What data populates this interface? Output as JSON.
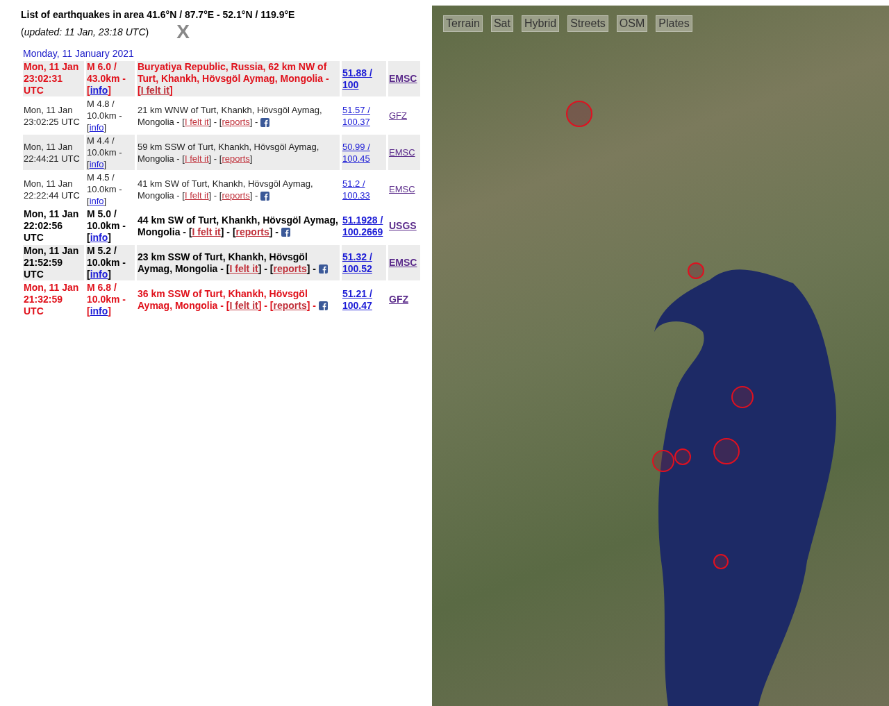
{
  "header": {
    "title": "List of earthquakes in area 41.6°N / 87.7°E - 52.1°N / 119.9°E",
    "updated_open": "(",
    "updated": "updated: 11 Jan, 23:18 UTC",
    "updated_close": ")",
    "close": "X"
  },
  "day": "Monday, 11 January 2021",
  "rows": [
    {
      "kind": "major",
      "shaded": true,
      "date": "Mon, 11 Jan 23:02:31 UTC",
      "magnitude": [
        {
          "kind": "text",
          "text": "M 6.0 / 43.0km - ["
        },
        {
          "kind": "info",
          "text": "info"
        },
        {
          "kind": "text",
          "text": "]"
        }
      ],
      "place": [
        {
          "kind": "text",
          "text": "Buryatiya Republic, Russia, 62 km NW of Turt, Khankh, Hövsgöl Aymag, Mongolia - ["
        },
        {
          "kind": "felt",
          "text": "I felt it"
        },
        {
          "kind": "text",
          "text": "]"
        }
      ],
      "coords": "51.88 / 100",
      "source": "EMSC"
    },
    {
      "kind": "minor",
      "shaded": false,
      "date": "Mon, 11 Jan 23:02:25 UTC",
      "magnitude": [
        {
          "kind": "text",
          "text": "M 4.8 / 10.0km - ["
        },
        {
          "kind": "info",
          "text": "info"
        },
        {
          "kind": "text",
          "text": "]"
        }
      ],
      "place": [
        {
          "kind": "text",
          "text": "21 km WNW of Turt, Khankh, Hövsgöl Aymag, Mongolia - ["
        },
        {
          "kind": "felt",
          "text": "I felt it"
        },
        {
          "kind": "text",
          "text": "] - ["
        },
        {
          "kind": "reports",
          "text": "reports"
        },
        {
          "kind": "text",
          "text": "] - "
        },
        {
          "kind": "share"
        }
      ],
      "coords": "51.57 / 100.37",
      "source": "GFZ"
    },
    {
      "kind": "minor",
      "shaded": true,
      "date": "Mon, 11 Jan 22:44:21 UTC",
      "magnitude": [
        {
          "kind": "text",
          "text": "M 4.4 / 10.0km - ["
        },
        {
          "kind": "info",
          "text": "info"
        },
        {
          "kind": "text",
          "text": "]"
        }
      ],
      "place": [
        {
          "kind": "text",
          "text": "59 km SSW of Turt, Khankh, Hövsgöl Aymag, Mongolia - ["
        },
        {
          "kind": "felt",
          "text": "I felt it"
        },
        {
          "kind": "text",
          "text": "] - ["
        },
        {
          "kind": "reports",
          "text": "reports"
        },
        {
          "kind": "text",
          "text": "]"
        }
      ],
      "coords": "50.99 / 100.45",
      "source": "EMSC"
    },
    {
      "kind": "minor",
      "shaded": false,
      "date": "Mon, 11 Jan 22:22:44 UTC",
      "magnitude": [
        {
          "kind": "text",
          "text": "M 4.5 / 10.0km - ["
        },
        {
          "kind": "info",
          "text": "info"
        },
        {
          "kind": "text",
          "text": "]"
        }
      ],
      "place": [
        {
          "kind": "text",
          "text": "41 km SW of Turt, Khankh, Hövsgöl Aymag, Mongolia - ["
        },
        {
          "kind": "felt",
          "text": "I felt it"
        },
        {
          "kind": "text",
          "text": "] - ["
        },
        {
          "kind": "reports",
          "text": "reports"
        },
        {
          "kind": "text",
          "text": "] - "
        },
        {
          "kind": "share"
        }
      ],
      "coords": "51.2 / 100.33",
      "source": "EMSC"
    },
    {
      "kind": "strong",
      "shaded": false,
      "date": "Mon, 11 Jan 22:02:56 UTC",
      "magnitude": [
        {
          "kind": "text",
          "text": "M 5.0 / 10.0km - ["
        },
        {
          "kind": "info",
          "text": "info"
        },
        {
          "kind": "text",
          "text": "]"
        }
      ],
      "place": [
        {
          "kind": "text",
          "text": "44 km SW of Turt, Khankh, Hövsgöl Aymag, Mongolia - ["
        },
        {
          "kind": "felt",
          "text": "I felt it"
        },
        {
          "kind": "text",
          "text": "] - ["
        },
        {
          "kind": "reports",
          "text": "reports"
        },
        {
          "kind": "text",
          "text": "] - "
        },
        {
          "kind": "share"
        }
      ],
      "coords": "51.1928 / 100.2669",
      "source": "USGS"
    },
    {
      "kind": "strong",
      "shaded": true,
      "date": "Mon, 11 Jan 21:52:59 UTC",
      "magnitude": [
        {
          "kind": "text",
          "text": "M 5.2 / 10.0km - ["
        },
        {
          "kind": "info",
          "text": "info"
        },
        {
          "kind": "text",
          "text": "]"
        }
      ],
      "place": [
        {
          "kind": "text",
          "text": "23 km SSW of Turt, Khankh, Hövsgöl Aymag, Mongolia - ["
        },
        {
          "kind": "felt",
          "text": "I felt it"
        },
        {
          "kind": "text",
          "text": "] - ["
        },
        {
          "kind": "reports",
          "text": "reports"
        },
        {
          "kind": "text",
          "text": "] - "
        },
        {
          "kind": "share"
        }
      ],
      "coords": "51.32 / 100.52",
      "source": "EMSC"
    },
    {
      "kind": "major",
      "shaded": false,
      "date": "Mon, 11 Jan 21:32:59 UTC",
      "magnitude": [
        {
          "kind": "text",
          "text": "M 6.8 / 10.0km - ["
        },
        {
          "kind": "info",
          "text": "info"
        },
        {
          "kind": "text",
          "text": "]"
        }
      ],
      "place": [
        {
          "kind": "text",
          "text": "36 km SSW of Turt, Khankh, Hövsgöl Aymag, Mongolia - ["
        },
        {
          "kind": "felt",
          "text": "I felt it"
        },
        {
          "kind": "text",
          "text": "] - ["
        },
        {
          "kind": "reports",
          "text": "reports"
        },
        {
          "kind": "text",
          "text": "] - "
        },
        {
          "kind": "share"
        }
      ],
      "coords": "51.21 / 100.47",
      "source": "GFZ"
    }
  ],
  "map": {
    "layers": [
      {
        "label": "Terrain"
      },
      {
        "label": "Sat"
      },
      {
        "label": "Hybrid"
      },
      {
        "label": "Streets"
      },
      {
        "label": "OSM"
      },
      {
        "label": "Plates"
      }
    ]
  }
}
